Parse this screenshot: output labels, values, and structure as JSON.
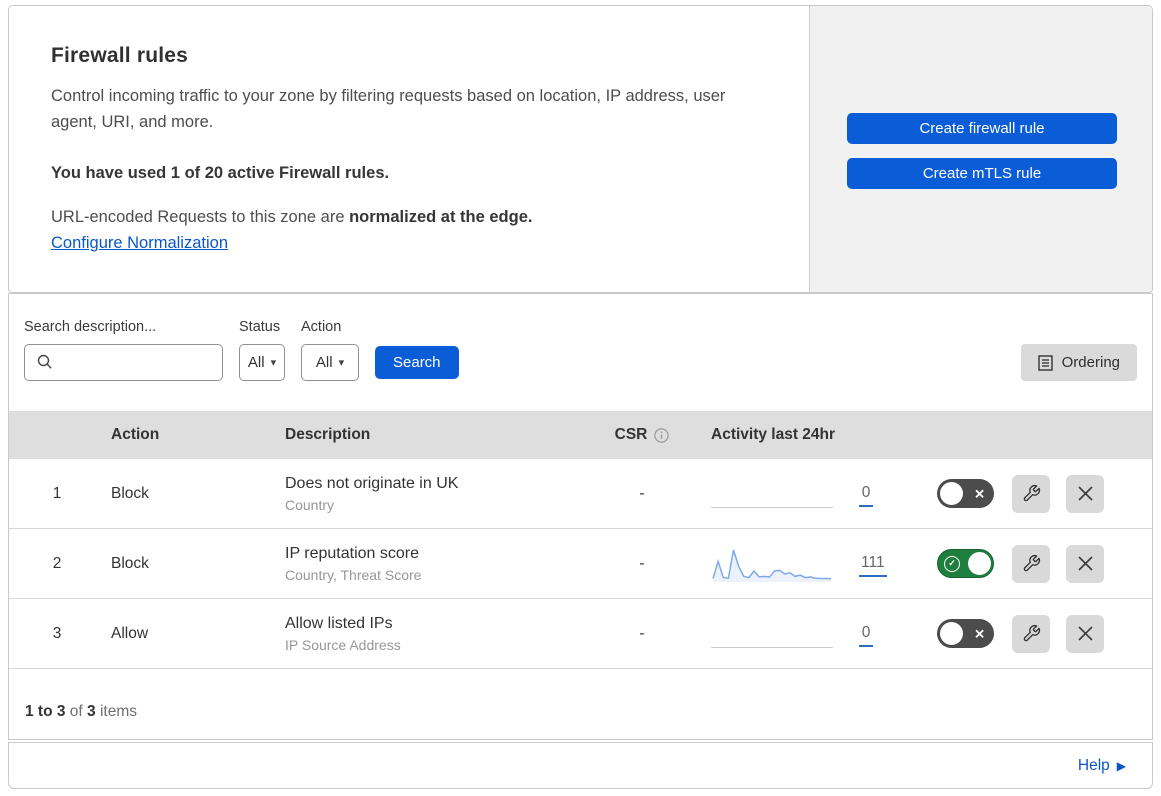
{
  "colors": {
    "accent_blue": "#0b5dd7",
    "link_blue": "#0a57c9",
    "toggle_on_green": "#1e7e3d",
    "toggle_off_gray": "#4c4c4c",
    "sparkline_blue": "#7fa8e6",
    "table_header_gray": "#dedede",
    "side_panel_gray": "#f1f1f1"
  },
  "icons": {
    "caret": "▾",
    "help_arrow": "▶",
    "toggle_on_glyph": "✓",
    "toggle_off_glyph": "✕"
  },
  "intro": {
    "title": "Firewall rules",
    "description": "Control incoming traffic to your zone by filtering requests based on location, IP address, user agent, URI, and more.",
    "usage_note": "You have used 1 of 20 active Firewall rules.",
    "normalization_prefix": "URL-encoded Requests to this zone are ",
    "normalization_bold": "normalized at the edge.",
    "normalization_link": "Configure Normalization"
  },
  "actions_panel": {
    "create_firewall_rule": "Create firewall rule",
    "create_mtls_rule": "Create mTLS rule"
  },
  "filters": {
    "search_label": "Search description...",
    "search_value": "",
    "status_label": "Status",
    "status_value": "All",
    "action_label": "Action",
    "action_value": "All",
    "search_button": "Search",
    "ordering_button": "Ordering"
  },
  "table": {
    "columns": {
      "action": "Action",
      "description": "Description",
      "csr": "CSR",
      "activity": "Activity last 24hr"
    },
    "rows": [
      {
        "index": "1",
        "action": "Block",
        "description": "Does not originate in UK",
        "fields": "Country",
        "csr": "-",
        "activity_count": "0",
        "enabled": false,
        "sparkline_index": 0
      },
      {
        "index": "2",
        "action": "Block",
        "description": "IP reputation score",
        "fields": "Country, Threat Score",
        "csr": "-",
        "activity_count": "111",
        "enabled": true,
        "sparkline_index": 1
      },
      {
        "index": "3",
        "action": "Allow",
        "description": "Allow listed IPs",
        "fields": "IP Source Address",
        "csr": "-",
        "activity_count": "0",
        "enabled": false,
        "sparkline_index": 2
      }
    ]
  },
  "footer": {
    "range": "1 to 3",
    "of": "of",
    "total": "3",
    "items": "items"
  },
  "help": {
    "label": "Help"
  },
  "chart_data": [
    {
      "type": "line",
      "series_label": "rule 1 activity last 24hr",
      "values": [
        0,
        0,
        0,
        0,
        0,
        0,
        0,
        0,
        0,
        0,
        0,
        0,
        0,
        0,
        0,
        0,
        0,
        0,
        0,
        0,
        0,
        0,
        0,
        0
      ],
      "count_label": "0"
    },
    {
      "type": "area",
      "series_label": "rule 2 activity last 24hr",
      "values": [
        5,
        62,
        8,
        6,
        100,
        45,
        12,
        8,
        30,
        10,
        12,
        10,
        30,
        32,
        20,
        24,
        12,
        16,
        8,
        10,
        6,
        5,
        5,
        4
      ],
      "ylim": [
        0,
        100
      ],
      "count_label": "111"
    },
    {
      "type": "line",
      "series_label": "rule 3 activity last 24hr",
      "values": [
        0,
        0,
        0,
        0,
        0,
        0,
        0,
        0,
        0,
        0,
        0,
        0,
        0,
        0,
        0,
        0,
        0,
        0,
        0,
        0,
        0,
        0,
        0,
        0
      ],
      "count_label": "0"
    }
  ]
}
